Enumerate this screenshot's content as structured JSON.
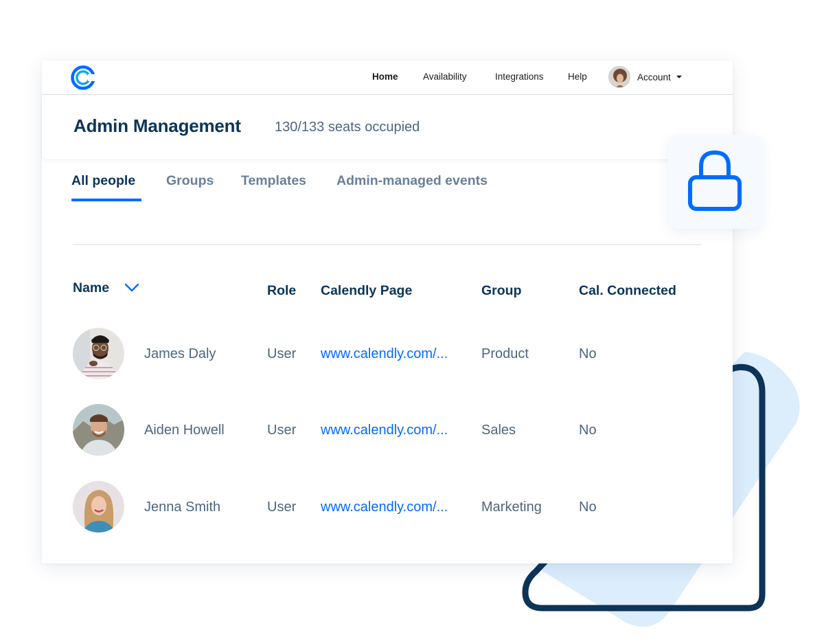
{
  "colors": {
    "brand_blue": "#006bff",
    "navy": "#0b3558",
    "muted_text": "#4d6580",
    "tab_inactive": "#6a7f97",
    "deco_light_blue": "#dcedfc"
  },
  "nav": {
    "logo_icon": "calendly-logo-icon",
    "items": [
      {
        "label": "Home",
        "active": true
      },
      {
        "label": "Availability",
        "active": false
      },
      {
        "label": "Integrations",
        "active": false
      },
      {
        "label": "Help",
        "active": false
      }
    ],
    "account": {
      "label": "Account",
      "icon": "caret-down-icon"
    }
  },
  "header": {
    "title": "Admin Management",
    "seats": "130/133 seats occupied"
  },
  "tabs": [
    {
      "label": "All people",
      "active": true
    },
    {
      "label": "Groups",
      "active": false
    },
    {
      "label": "Templates",
      "active": false
    },
    {
      "label": "Admin-managed events",
      "active": false
    }
  ],
  "table": {
    "columns": [
      "Name",
      "Role",
      "Calendly Page",
      "Group",
      "Cal. Connected"
    ],
    "sort_icon": "chevron-down-icon",
    "rows": [
      {
        "name": "James Daly",
        "role": "User",
        "page": "www.calendly.com/...",
        "group": "Product",
        "connected": "No"
      },
      {
        "name": "Aiden Howell",
        "role": "User",
        "page": "www.calendly.com/...",
        "group": "Sales",
        "connected": "No"
      },
      {
        "name": "Jenna Smith",
        "role": "User",
        "page": "www.calendly.com/...",
        "group": "Marketing",
        "connected": "No"
      }
    ]
  },
  "badge": {
    "icon": "lock-icon"
  }
}
